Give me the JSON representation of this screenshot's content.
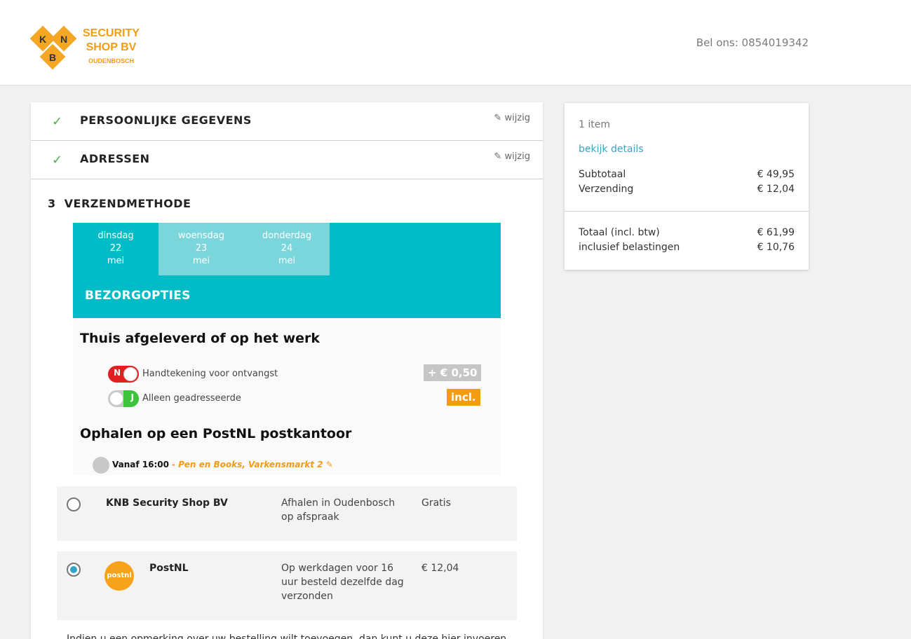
{
  "header": {
    "logo_line1": "SECURITY",
    "logo_line2": "SHOP BV",
    "logo_line3": "OUDENBOSCH",
    "logo_letters": [
      "K",
      "N",
      "B"
    ],
    "phone": "Bel ons: 0854019342"
  },
  "steps": [
    {
      "title": "PERSOONLIJKE GEGEVENS",
      "edit": "wijzig",
      "icon": "check-icon"
    },
    {
      "title": "ADRESSEN",
      "edit": "wijzig",
      "icon": "check-icon"
    }
  ],
  "step3": {
    "number": "3",
    "title": "VERZENDMETHODE"
  },
  "delivery": {
    "days": [
      {
        "weekday": "dinsdag",
        "day": "22",
        "month": "mei"
      },
      {
        "weekday": "woensdag",
        "day": "23",
        "month": "mei"
      },
      {
        "weekday": "donderdag",
        "day": "24",
        "month": "mei"
      }
    ],
    "heading": "BEZORGOPTIES",
    "home_title": "Thuis afgeleverd of op het werk",
    "signature": {
      "toggle": "N",
      "label": "Handtekening voor ontvangst",
      "price": "+ € 0,50"
    },
    "addressee": {
      "toggle": "J",
      "label": "Alleen geadresseerde",
      "price": "incl."
    },
    "pickup_title": "Ophalen op een PostNL postkantoor",
    "pickup_time": "Vanaf 16:00",
    "pickup_location": " - Pen en Books, Varkensmarkt 2"
  },
  "shipping": [
    {
      "name": "KNB Security Shop BV",
      "desc": "Afhalen in Oudenbosch op afspraak",
      "price": "Gratis",
      "selected": false
    },
    {
      "name": "PostNL",
      "logo": "postnl",
      "desc": "Op werkdagen voor 16 uur besteld dezelfde dag verzonden",
      "price": "€ 12,04",
      "selected": true
    }
  ],
  "note": "Indien u een opmerking over uw bestelling wilt toevoegen, dan kunt u deze hier invoeren",
  "summary": {
    "items": "1 item",
    "details_link": "bekijk details",
    "subtotal_label": "Subtotaal",
    "subtotal_value": "€ 49,95",
    "shipping_label": "Verzending",
    "shipping_value": "€ 12,04",
    "total_label": "Totaal (incl. btw)",
    "total_value": "€ 61,99",
    "tax_label": "inclusief belastingen",
    "tax_value": "€ 10,76"
  },
  "colors": {
    "teal": "#00bcc6",
    "orange": "#f39c12",
    "green": "#4caf50",
    "link": "#3ea3c3"
  }
}
